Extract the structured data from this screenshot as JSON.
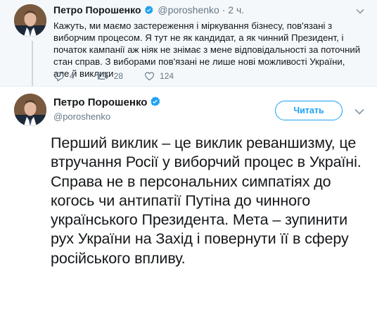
{
  "parent_tweet": {
    "author_name": "Петро Порошенко",
    "handle": "@poroshenko",
    "separator": "·",
    "time": "2 ч.",
    "text": "Кажуть, ми маємо застереження і міркування бізнесу, пов'язані з виборчим процесом. Я тут не як кандидат, а як чинний Президент, і початок кампанії аж ніяк не знімає з мене відповідальності за поточний стан справ. З виборами пов'язані не лише нові можливості України, але й виклики",
    "replies": "4",
    "retweets": "28",
    "likes": "124"
  },
  "main_tweet": {
    "author_name": "Петро Порошенко",
    "handle": "@poroshenko",
    "follow_label": "Читать",
    "text": "Перший виклик – це виклик реваншизму, це втручання Росії у виборчий процес в Україні. Справа не в персональних симпатіях до когось чи антипатії Путіна до чинного українського Президента. Мета – зупинити рух України на Захід і повернути її в сферу російського впливу."
  },
  "colors": {
    "accent": "#1da1f2",
    "muted": "#657786",
    "text": "#14171a",
    "parent_bg": "#f5f8fa"
  },
  "icons": [
    "verified-icon",
    "caret-down-icon",
    "reply-icon",
    "retweet-icon",
    "like-icon"
  ]
}
